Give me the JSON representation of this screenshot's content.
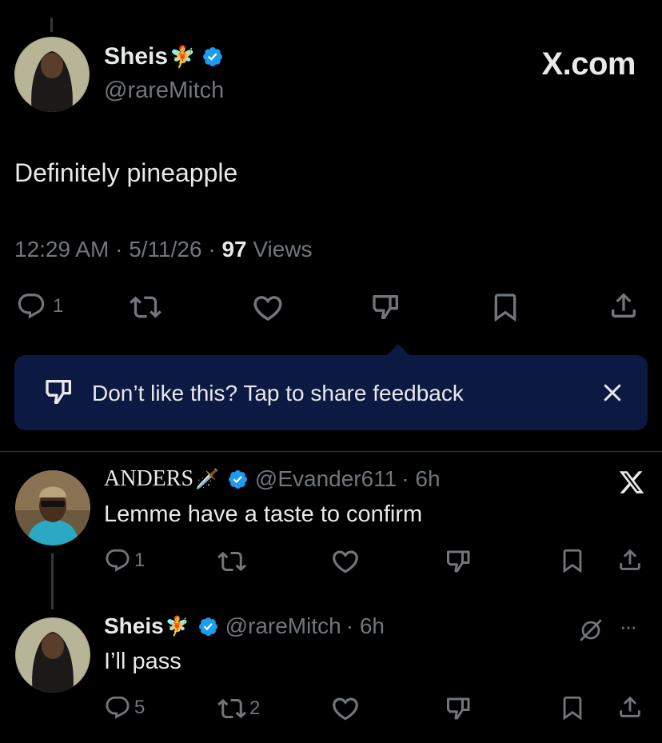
{
  "colors": {
    "background": "#000000",
    "text_primary": "#e7e9ea",
    "text_secondary": "#71767b",
    "verified_blue": "#1d9bf0",
    "banner_bg": "#0c1a43"
  },
  "brand": {
    "label": "X.com"
  },
  "main_post": {
    "author_name": "Sheis",
    "author_emoji": "🧚",
    "handle": "@rareMitch",
    "text": "Definitely pineapple",
    "time": "12:29 AM",
    "sep1": "·",
    "date": "5/11/26",
    "sep2": "·",
    "views_count": "97",
    "views_label": "Views",
    "actions": {
      "reply_count": "1"
    }
  },
  "feedback_banner": {
    "text": "Don’t like this? Tap to share feedback",
    "icons": [
      "thumbs-down-icon",
      "close-icon"
    ]
  },
  "replies": [
    {
      "author_name": "ANDERS",
      "author_emoji": "🗡️",
      "handle": "@Evander611",
      "time": "· 6h",
      "text": "Lemme have a taste to confirm",
      "reply_count": "1",
      "repost_count": "",
      "corner_icon": "x-logo-icon"
    },
    {
      "author_name": "Sheis",
      "author_emoji": "🧚",
      "handle": "@rareMitch",
      "time": "· 6h",
      "text": "I’ll pass",
      "reply_count": "5",
      "repost_count": "2",
      "corner_icon": "grok-icon",
      "more_label": "···"
    }
  ]
}
